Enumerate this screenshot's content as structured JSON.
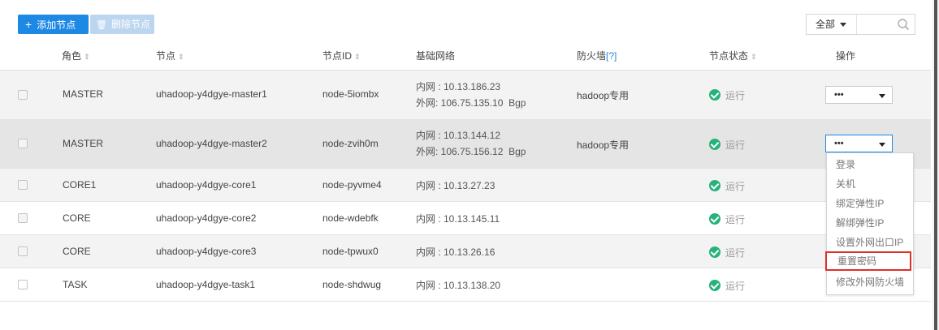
{
  "toolbar": {
    "add_label": "添加节点",
    "add_icon": "plus-icon",
    "delete_label": "删除节点",
    "delete_icon": "trash-icon",
    "filter_value": "全部",
    "filter_input_value": "",
    "search_icon": "search-icon"
  },
  "columns": {
    "role": "角色",
    "node": "节点",
    "node_id": "节点ID",
    "network": "基础网络",
    "firewall": "防火墙",
    "firewall_help": "[?]",
    "status": "节点状态",
    "ops": "操作"
  },
  "rows": [
    {
      "role": "MASTER",
      "node": "uhadoop-y4dgye-master1",
      "node_id": "node-5iombx",
      "net_inner": "内网 : 10.13.186.23",
      "net_outer": "外网: 106.75.135.10  Bgp",
      "firewall": "hadoop专用",
      "status": "运行",
      "op": "•••"
    },
    {
      "role": "MASTER",
      "node": "uhadoop-y4dgye-master2",
      "node_id": "node-zvih0m",
      "net_inner": "内网 : 10.13.144.12",
      "net_outer": "外网: 106.75.156.12  Bgp",
      "firewall": "hadoop专用",
      "status": "运行",
      "op": "•••"
    },
    {
      "role": "CORE1",
      "node": "uhadoop-y4dgye-core1",
      "node_id": "node-pyvme4",
      "net_inner": "内网 : 10.13.27.23",
      "status": "运行"
    },
    {
      "role": "CORE",
      "node": "uhadoop-y4dgye-core2",
      "node_id": "node-wdebfk",
      "net_inner": "内网 : 10.13.145.11",
      "status": "运行"
    },
    {
      "role": "CORE",
      "node": "uhadoop-y4dgye-core3",
      "node_id": "node-tpwux0",
      "net_inner": "内网 : 10.13.26.16",
      "status": "运行"
    },
    {
      "role": "TASK",
      "node": "uhadoop-y4dgye-task1",
      "node_id": "node-shdwug",
      "net_inner": "内网 : 10.13.138.20",
      "status": "运行"
    }
  ],
  "menu": {
    "items": [
      "登录",
      "关机",
      "绑定弹性IP",
      "解绑弹性IP",
      "设置外网出口IP",
      "重置密码",
      "修改外网防火墙"
    ],
    "highlighted": "重置密码"
  },
  "colors": {
    "primary": "#1e88e5",
    "disabled": "#bcd6ef",
    "status_ok": "#26b27a",
    "highlight": "#e0302b"
  }
}
